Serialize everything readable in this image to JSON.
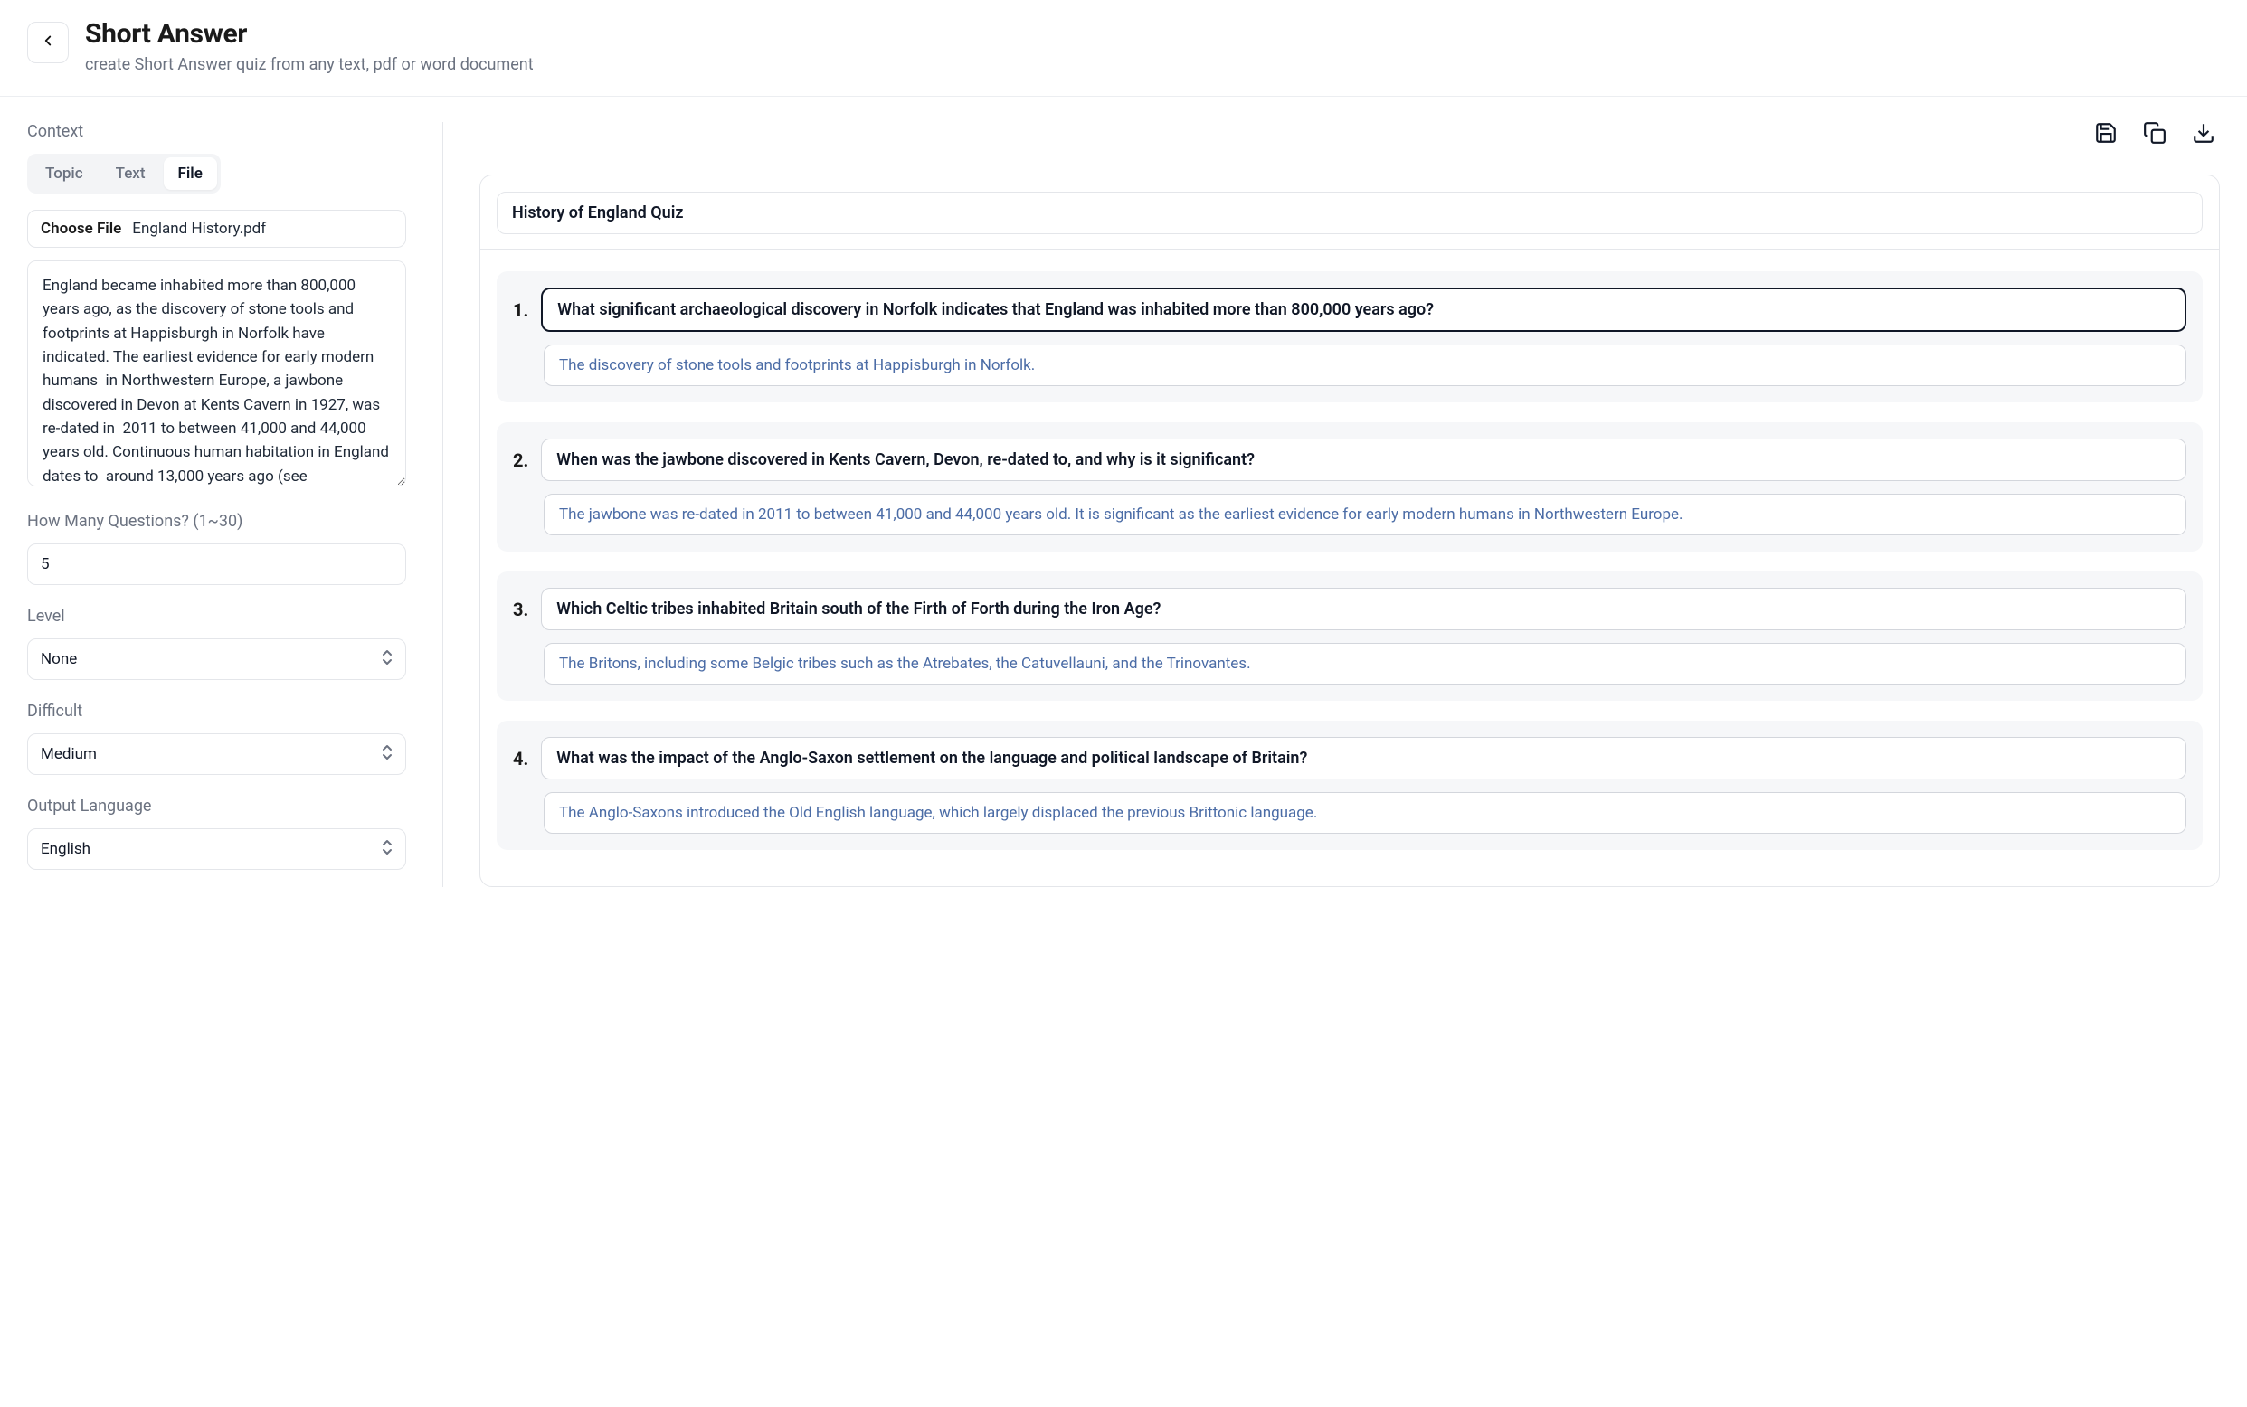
{
  "header": {
    "title": "Short Answer",
    "subtitle": "create Short Answer quiz from any text, pdf or word document"
  },
  "context": {
    "label": "Context",
    "tabs": {
      "topic": "Topic",
      "text": "Text",
      "file": "File"
    },
    "choose_file_label": "Choose File",
    "file_name": "England History.pdf",
    "textarea_value": "England became inhabited more than 800,000 years ago, as the discovery of stone tools and footprints at Happisburgh in Norfolk have indicated. The earliest evidence for early modern humans  in Northwestern Europe, a jawbone discovered in Devon at Kents Cavern in 1927, was re-dated in  2011 to between 41,000 and 44,000 years old. Continuous human habitation in England dates to  around 13,000 years ago (see Creswellian), at the end of the Last Glacial Period. The region has  numerous remains from the"
  },
  "how_many": {
    "label": "How Many Questions? (1~30)",
    "value": "5"
  },
  "level": {
    "label": "Level",
    "value": "None"
  },
  "difficult": {
    "label": "Difficult",
    "value": "Medium"
  },
  "output_language": {
    "label": "Output Language",
    "value": "English"
  },
  "quiz": {
    "title": "History of England Quiz",
    "questions": [
      {
        "num": "1.",
        "q": "What significant archaeological discovery in Norfolk indicates that England was inhabited more than 800,000 years ago?",
        "a": "The discovery of stone tools and footprints at Happisburgh in Norfolk.",
        "focused": true
      },
      {
        "num": "2.",
        "q": "When was the jawbone discovered in Kents Cavern, Devon, re-dated to, and why is it significant?",
        "a": "The jawbone was re-dated in 2011 to between 41,000 and 44,000 years old. It is significant as the earliest evidence for early modern humans in Northwestern Europe.",
        "focused": false
      },
      {
        "num": "3.",
        "q": "Which Celtic tribes inhabited Britain south of the Firth of Forth during the Iron Age?",
        "a": "The Britons, including some Belgic tribes such as the Atrebates, the Catuvellauni, and the Trinovantes.",
        "focused": false
      },
      {
        "num": "4.",
        "q": "What was the impact of the Anglo-Saxon settlement on the language and political landscape of Britain?",
        "a": "The Anglo-Saxons introduced the Old English language, which largely displaced the previous Brittonic language.",
        "focused": false
      }
    ]
  }
}
